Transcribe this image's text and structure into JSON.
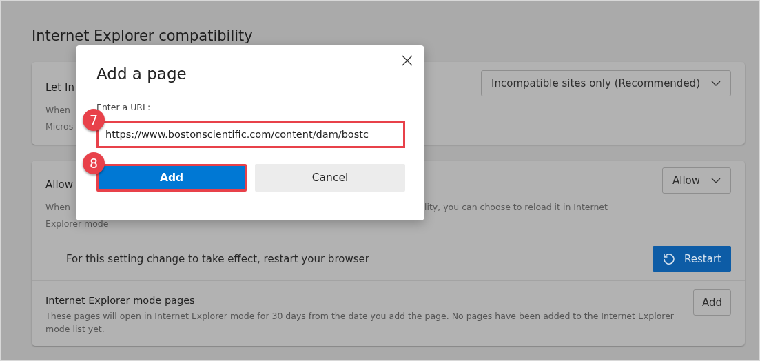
{
  "page": {
    "title": "Internet Explorer compatibility"
  },
  "cards": [
    {
      "title": "Let In",
      "description_lines": [
        {
          "left": "When"
        },
        {
          "left": "Micros"
        }
      ],
      "dropdown": "Incompatible sites only (Recommended)"
    },
    {
      "title": "Allow",
      "description_lines": [
        {
          "left": "When",
          "right": "lity, you can choose to reload it in Internet"
        },
        {
          "left": "Explorer mode"
        }
      ],
      "dropdown": "Allow",
      "notice": "For this setting change to take effect, restart your browser",
      "notice_button": "Restart",
      "section": {
        "title": "Internet Explorer mode pages",
        "description": "These pages will open in Internet Explorer mode for 30 days from the date you add the page. No pages have been added to the Internet Explorer mode list yet.",
        "button": "Add"
      }
    }
  ],
  "dialog": {
    "title": "Add a page",
    "field_label": "Enter a URL:",
    "field_value": "https://www.bostonscientific.com/content/dam/bostc",
    "field_step": "7",
    "buttons": [
      {
        "label": "Add",
        "kind": "primary",
        "step": "8"
      },
      {
        "label": "Cancel",
        "kind": "secondary"
      }
    ]
  }
}
